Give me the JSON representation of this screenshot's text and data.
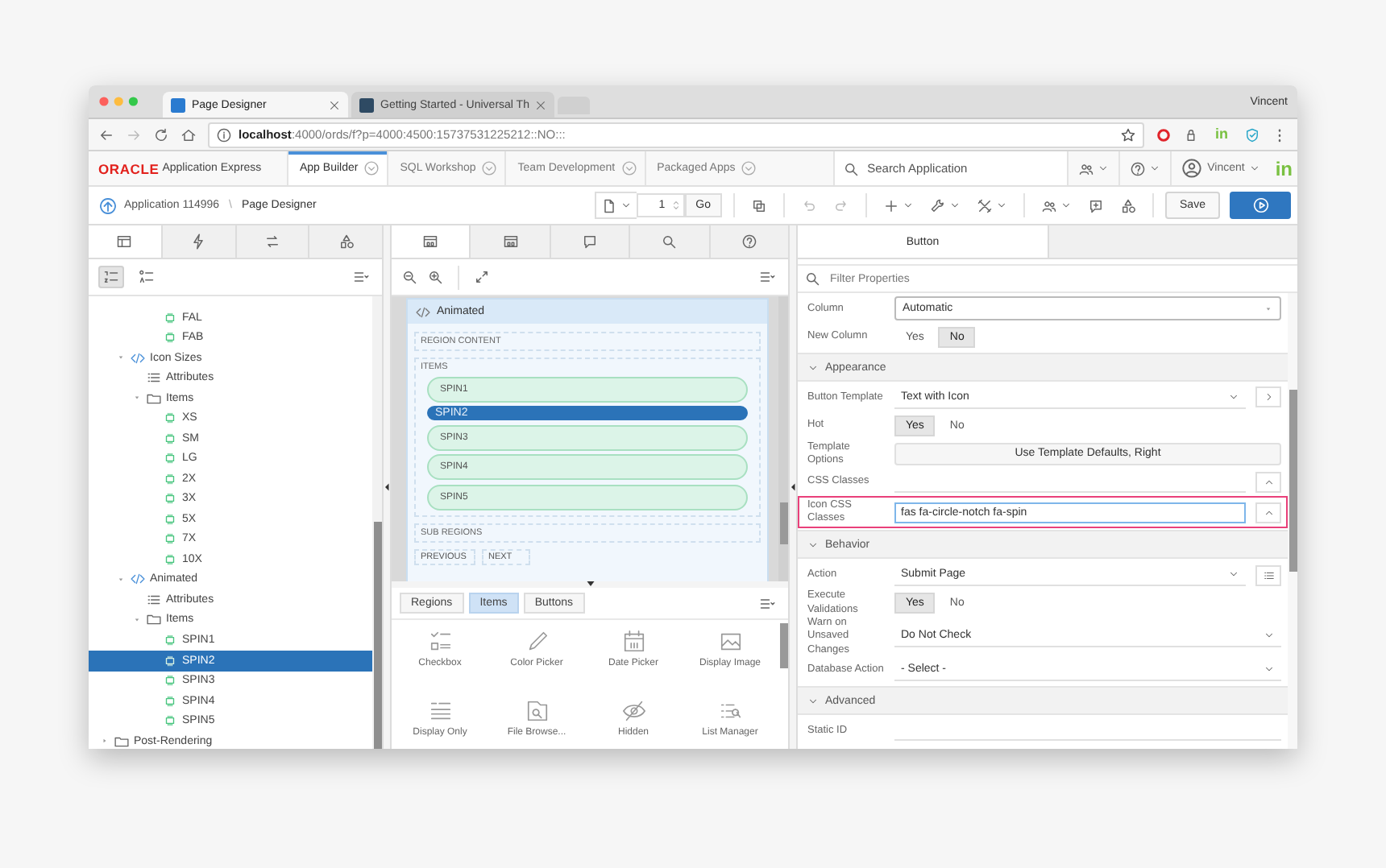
{
  "browser": {
    "tabs": [
      {
        "title": "Page Designer",
        "selected": true
      },
      {
        "title": "Getting Started - Universal Th",
        "selected": false
      }
    ],
    "profile": "Vincent",
    "url_host": "localhost",
    "url_path": ":4000/ords/f?p=4000:4500:15737531225212::NO:::",
    "extension_badge": "in"
  },
  "app_header": {
    "logo": "ORACLE",
    "product": "Application Express",
    "nav": [
      {
        "label": "App Builder",
        "selected": true
      },
      {
        "label": "SQL Workshop",
        "selected": false
      },
      {
        "label": "Team Development",
        "selected": false
      },
      {
        "label": "Packaged Apps",
        "selected": false
      }
    ],
    "search_placeholder": "Search Application",
    "user": "Vincent",
    "badge": "in"
  },
  "toolbar": {
    "breadcrumb": [
      {
        "label": "Application 114996"
      },
      {
        "label": "Page Designer"
      }
    ],
    "separator": "\\",
    "page_number": "1",
    "go": "Go",
    "save": "Save"
  },
  "left_panel": {
    "tabs": [
      {
        "selected": true
      },
      {
        "selected": false
      },
      {
        "selected": false
      },
      {
        "selected": false
      }
    ],
    "view_buttons": [
      {
        "selected": true
      },
      {
        "selected": false
      }
    ],
    "tree": [
      {
        "kind": "continued",
        "children": [
          {
            "kind": "continued",
            "children": [
              {
                "kind": "continued",
                "children": [
                  {
                    "label": "FAL",
                    "kind": "item",
                    "selected": false
                  },
                  {
                    "label": "FAB",
                    "kind": "item",
                    "selected": false
                  }
                ]
              }
            ]
          },
          {
            "label": "Icon Sizes",
            "kind": "region",
            "expanded": true,
            "selected": false,
            "children": [
              {
                "label": "Attributes",
                "kind": "attributes",
                "selected": false
              },
              {
                "label": "Items",
                "kind": "folder",
                "expanded": true,
                "selected": false,
                "children": [
                  {
                    "label": "XS",
                    "kind": "item",
                    "selected": false
                  },
                  {
                    "label": "SM",
                    "kind": "item",
                    "selected": false
                  },
                  {
                    "label": "LG",
                    "kind": "item",
                    "selected": false
                  },
                  {
                    "label": "2X",
                    "kind": "item",
                    "selected": false
                  },
                  {
                    "label": "3X",
                    "kind": "item",
                    "selected": false
                  },
                  {
                    "label": "5X",
                    "kind": "item",
                    "selected": false
                  },
                  {
                    "label": "7X",
                    "kind": "item",
                    "selected": false
                  },
                  {
                    "label": "10X",
                    "kind": "item",
                    "selected": false
                  }
                ]
              }
            ]
          },
          {
            "label": "Animated",
            "kind": "region",
            "expanded": true,
            "selected": false,
            "children": [
              {
                "label": "Attributes",
                "kind": "attributes",
                "selected": false
              },
              {
                "label": "Items",
                "kind": "folder",
                "expanded": true,
                "selected": false,
                "children": [
                  {
                    "label": "SPIN1",
                    "kind": "item",
                    "selected": false
                  },
                  {
                    "label": "SPIN2",
                    "kind": "item",
                    "selected": true
                  },
                  {
                    "label": "SPIN3",
                    "kind": "item",
                    "selected": false
                  },
                  {
                    "label": "SPIN4",
                    "kind": "item",
                    "selected": false
                  },
                  {
                    "label": "SPIN5",
                    "kind": "item",
                    "selected": false
                  }
                ]
              }
            ]
          }
        ]
      },
      {
        "label": "Post-Rendering",
        "kind": "folder",
        "expanded": false,
        "selected": false
      }
    ]
  },
  "center_panel": {
    "tabs": [
      {
        "selected": true
      },
      {
        "selected": false
      },
      {
        "selected": false
      },
      {
        "selected": false
      },
      {
        "selected": false
      }
    ],
    "region": {
      "title": "Animated",
      "content_label": "REGION CONTENT",
      "items_label": "ITEMS",
      "items": [
        {
          "label": "SPIN1",
          "selected": false
        },
        {
          "label": "SPIN2",
          "selected": true
        },
        {
          "label": "SPIN3",
          "selected": false
        },
        {
          "label": "SPIN4",
          "selected": false
        },
        {
          "label": "SPIN5",
          "selected": false
        }
      ],
      "sub_regions_label": "SUB REGIONS",
      "positions": [
        "PREVIOUS",
        "NEXT"
      ]
    },
    "gallery": {
      "tabs": [
        {
          "label": "Regions",
          "selected": false
        },
        {
          "label": "Items",
          "selected": true
        },
        {
          "label": "Buttons",
          "selected": false
        }
      ],
      "items": [
        {
          "label": "Checkbox"
        },
        {
          "label": "Color Picker"
        },
        {
          "label": "Date Picker"
        },
        {
          "label": "Display Image"
        },
        {
          "label": "Display Only"
        },
        {
          "label": "File Browse..."
        },
        {
          "label": "Hidden"
        },
        {
          "label": "List Manager"
        }
      ]
    }
  },
  "right_panel": {
    "tabs": [
      {
        "label": "Button",
        "selected": true
      }
    ],
    "filter_placeholder": "Filter Properties",
    "properties": [
      {
        "kind": "select",
        "label": "Column",
        "value": "Automatic"
      },
      {
        "kind": "toggle",
        "label": "New Column",
        "options": [
          {
            "label": "Yes",
            "selected": false
          },
          {
            "label": "No",
            "selected": true
          }
        ]
      },
      {
        "kind": "group",
        "label": "Appearance",
        "expanded": true
      },
      {
        "kind": "select",
        "label": "Button Template",
        "value": "Text with Icon"
      },
      {
        "kind": "toggle",
        "label": "Hot",
        "options": [
          {
            "label": "Yes",
            "selected": true
          },
          {
            "label": "No",
            "selected": false
          }
        ]
      },
      {
        "kind": "button",
        "label": "Template Options",
        "value": "Use Template Defaults, Right"
      },
      {
        "kind": "text",
        "label": "CSS Classes"
      },
      {
        "kind": "text",
        "label": "Icon CSS Classes",
        "value": "fas fa-circle-notch fa-spin",
        "highlighted": true
      },
      {
        "kind": "group",
        "label": "Behavior",
        "expanded": true
      },
      {
        "kind": "select",
        "label": "Action",
        "value": "Submit Page"
      },
      {
        "kind": "toggle",
        "label": "Execute Validations",
        "options": [
          {
            "label": "Yes",
            "selected": true
          },
          {
            "label": "No",
            "selected": false
          }
        ]
      },
      {
        "kind": "select",
        "label": "Warn on Unsaved Changes",
        "value": "Do Not Check"
      },
      {
        "kind": "select",
        "label": "Database Action",
        "value": "- Select -"
      },
      {
        "kind": "group",
        "label": "Advanced",
        "expanded": true
      },
      {
        "kind": "text",
        "label": "Static ID"
      }
    ]
  }
}
